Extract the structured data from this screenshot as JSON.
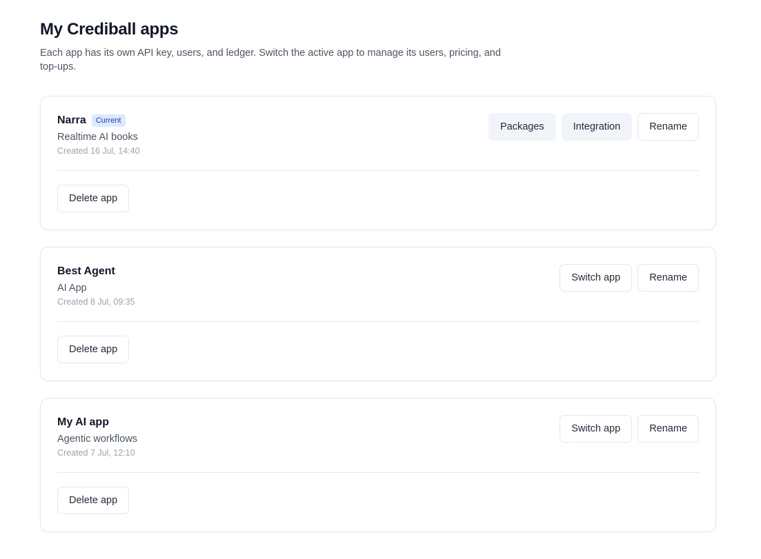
{
  "page": {
    "title": "My Crediball apps",
    "description": "Each app has its own API key, users, and ledger. Switch the active app to manage its users, pricing, and top-ups."
  },
  "apps": [
    {
      "name": "Narra",
      "badge": "Current",
      "subtitle": "Realtime AI books",
      "created": "Created 16 Jul, 14:40",
      "actions": {
        "packages": "Packages",
        "integration": "Integration",
        "rename": "Rename"
      },
      "delete_label": "Delete app"
    },
    {
      "name": "Best Agent",
      "subtitle": "AI App",
      "created": "Created 8 Jul, 09:35",
      "actions": {
        "switch": "Switch app",
        "rename": "Rename"
      },
      "delete_label": "Delete app"
    },
    {
      "name": "My AI app",
      "subtitle": "Agentic workflows",
      "created": "Created 7 Jul, 12:10",
      "actions": {
        "switch": "Switch app",
        "rename": "Rename"
      },
      "delete_label": "Delete app"
    }
  ],
  "colors": {
    "badge_bg": "#dbeafe",
    "badge_text": "#1e40af",
    "soft_button_bg": "#f1f5f9",
    "border": "#e5e7eb"
  }
}
